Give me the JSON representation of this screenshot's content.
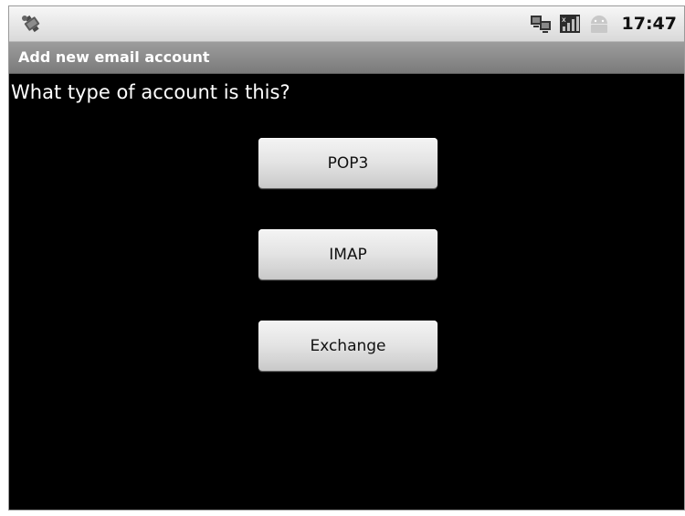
{
  "status_bar": {
    "time": "17:47",
    "icons": [
      "usb-debug-icon",
      "network-icon",
      "signal-icon",
      "android-icon"
    ]
  },
  "title_bar": {
    "title": "Add new email account"
  },
  "main": {
    "question": "What type of account is this?",
    "buttons": [
      {
        "label": "POP3"
      },
      {
        "label": "IMAP"
      },
      {
        "label": "Exchange"
      }
    ]
  },
  "colors": {
    "background": "#000000",
    "title_bar": "#8a8a8a",
    "status_bar": "#e6e6e6",
    "button": "#e0e0e0"
  }
}
